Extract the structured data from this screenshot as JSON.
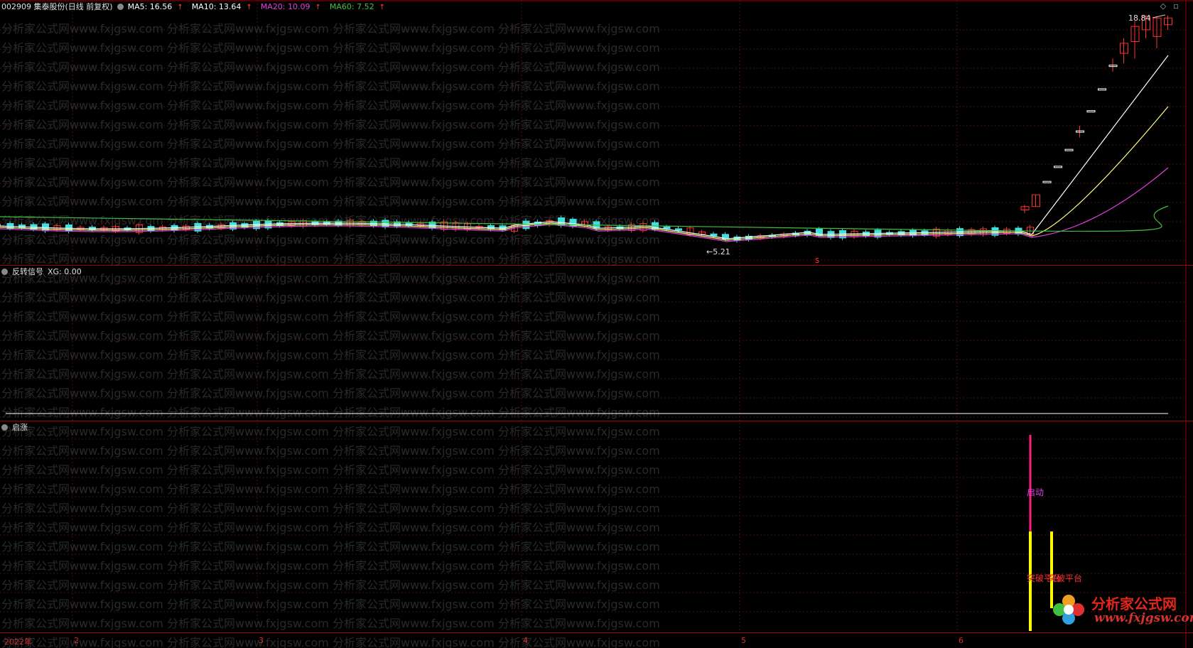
{
  "header": {
    "stock": "002909 集泰股份(日线 前复权)",
    "ma": [
      {
        "label": "MA5: 16.56",
        "color": "#ffffff"
      },
      {
        "label": "MA10: 13.64",
        "color": "#ffffff"
      },
      {
        "label": "MA20: 10.09",
        "color": "#e040e0"
      },
      {
        "label": "MA60: 7.52",
        "color": "#40c040"
      }
    ],
    "arrow": "↑"
  },
  "price_labels": {
    "high": "18.84",
    "low": "5.21",
    "low_arrow": "←"
  },
  "signal_mark": "s",
  "pane2": {
    "title": "反转信号",
    "xg": "XG: 0.00"
  },
  "pane3": {
    "title": "启涨",
    "label_start": "启动",
    "label_breakout": "突破平台",
    "label_breakout2": "突破平台"
  },
  "xaxis": {
    "labels": [
      "2022年",
      "2",
      "3",
      "4",
      "5",
      "6"
    ]
  },
  "watermark": "分析家公式网www.fxjgsw.com",
  "logo": {
    "brand": "分析家公式网",
    "url": "www.fxjgsw.com"
  },
  "colors": {
    "up": "#ff3030",
    "down": "#40e0e0",
    "ma5": "#ffffff",
    "ma10": "#ffff80",
    "ma20": "#e040e0",
    "ma60": "#40c040",
    "signal_bar": "#ff1f7a",
    "breakout_bar": "#ffff00"
  },
  "chart_data": {
    "type": "candlestick",
    "ohlc_recent": [
      {
        "o": 7.3,
        "h": 7.6,
        "l": 7.1,
        "c": 7.5
      },
      {
        "o": 7.5,
        "h": 8.2,
        "l": 7.5,
        "c": 8.2
      },
      {
        "o": 9.0,
        "h": 9.0,
        "l": 9.0,
        "c": 9.0
      },
      {
        "o": 9.9,
        "h": 9.9,
        "l": 9.9,
        "c": 9.9
      },
      {
        "o": 10.9,
        "h": 10.9,
        "l": 10.9,
        "c": 10.9
      },
      {
        "o": 12.0,
        "h": 12.3,
        "l": 11.6,
        "c": 12.0
      },
      {
        "o": 13.2,
        "h": 13.2,
        "l": 13.2,
        "c": 13.2
      },
      {
        "o": 14.5,
        "h": 14.5,
        "l": 14.5,
        "c": 14.5
      },
      {
        "o": 15.9,
        "h": 16.3,
        "l": 15.5,
        "c": 15.9
      },
      {
        "o": 16.6,
        "h": 17.5,
        "l": 16.0,
        "c": 17.2
      },
      {
        "o": 17.3,
        "h": 18.5,
        "l": 16.3,
        "c": 18.2
      },
      {
        "o": 18.0,
        "h": 18.84,
        "l": 17.5,
        "c": 18.8
      },
      {
        "o": 17.6,
        "h": 18.8,
        "l": 16.9,
        "c": 18.7
      },
      {
        "o": 18.3,
        "h": 18.84,
        "l": 18.0,
        "c": 18.7
      }
    ]
  }
}
